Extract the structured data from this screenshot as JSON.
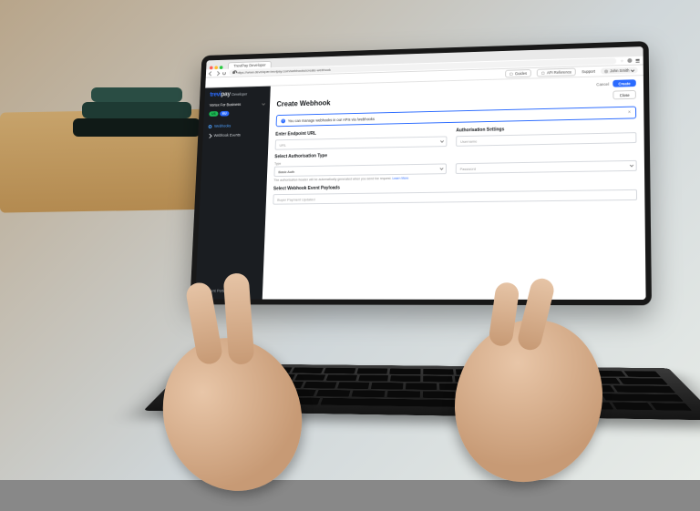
{
  "browser": {
    "tab_title": "TreviPay Developer",
    "url": "https://www.developer.trevipay.com/webhooks/create-webhook"
  },
  "topbar": {
    "guides": "Guides",
    "api_reference": "API Reference",
    "support": "Support",
    "user_name": "John Smith"
  },
  "sidebar": {
    "brand_prefix": "trevi",
    "brand_suffix": "pay",
    "brand_sub": "Developer",
    "company": "Vortex For Business",
    "badges": [
      "US",
      "EU"
    ],
    "items": [
      {
        "label": "Webhooks"
      },
      {
        "label": "Webhook Events"
      }
    ],
    "footer": "Client Portal"
  },
  "page": {
    "title": "Create Webhook",
    "cancel": "Cancel",
    "create": "Create",
    "close": "Close",
    "alert": "You can manage webhooks in our APIs via /webhooks",
    "sections": {
      "endpoint_title": "Enter Endpoint URL",
      "url_label": "URL",
      "auth_settings_title": "Authorisation Settings",
      "username_label": "Username",
      "auth_type_title": "Select Authorisation Type",
      "type_label": "Type",
      "type_value": "Basic Auth",
      "password_label": "Password",
      "auth_helper_text": "The authorisation header will be automatically generated when you send the request.",
      "learn_more": "Learn More",
      "payloads_title": "Select Webhook Event Payloads",
      "payload_option": "Buyer Payment Updated"
    }
  }
}
